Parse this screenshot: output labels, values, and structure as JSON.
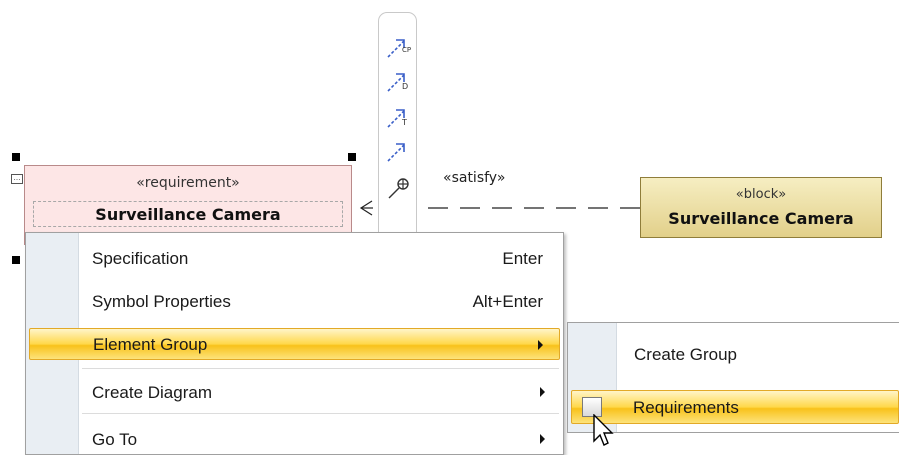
{
  "toolbar": {
    "tools": [
      {
        "icon": "containment-path-icon",
        "badge": "CP"
      },
      {
        "icon": "derive-path-icon",
        "badge": "D"
      },
      {
        "icon": "trace-path-icon",
        "badge": "T"
      },
      {
        "icon": "satisfy-path-icon",
        "badge": ""
      },
      {
        "icon": "containment-icon",
        "badge": ""
      }
    ]
  },
  "diagram": {
    "requirement": {
      "stereotype": "«requirement»",
      "name": "Surveillance Camera"
    },
    "block": {
      "stereotype": "«block»",
      "name": "Surveillance Camera"
    },
    "relationship_label": "«satisfy»"
  },
  "context_menu": {
    "items": [
      {
        "label": "Specification",
        "shortcut": "Enter"
      },
      {
        "label": "Symbol Properties",
        "shortcut": "Alt+Enter"
      },
      {
        "label": "Element Group",
        "submenu": true,
        "highlighted": true
      },
      {
        "label": "Create Diagram",
        "submenu": true
      },
      {
        "label": "Go To",
        "submenu": true
      }
    ]
  },
  "submenu": {
    "items": [
      {
        "label": "Create Group"
      },
      {
        "label": "Requirements",
        "checked": false,
        "highlighted": true
      }
    ]
  },
  "colors": {
    "highlight": "#ffd84a",
    "requirement_fill": "#fde6e6",
    "block_fill": "#e8d898"
  }
}
